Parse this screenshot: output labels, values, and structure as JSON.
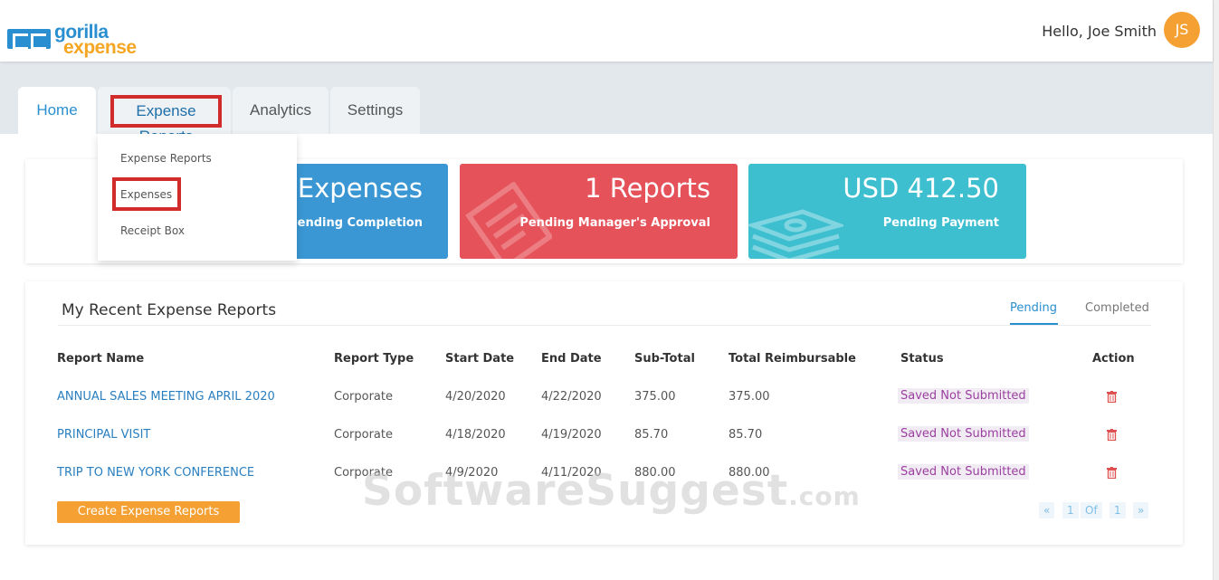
{
  "header": {
    "logo_text_top": "gorilla",
    "logo_text_bottom": "expense",
    "greeting": "Hello, Joe Smith",
    "avatar_initials": "JS"
  },
  "tabs": [
    {
      "label": "Home",
      "active": true
    },
    {
      "label": "Expense Reports",
      "highlighted": true
    },
    {
      "label": "Analytics"
    },
    {
      "label": "Settings"
    }
  ],
  "dropdown": {
    "items": [
      "Expense Reports",
      "Expenses",
      "Receipt Box"
    ]
  },
  "summary": {
    "cards": [
      {
        "big": "Expenses",
        "sub": "Pending Completion",
        "color": "#3a97d3"
      },
      {
        "big": "1 Reports",
        "sub": "Pending Manager's Approval",
        "color": "#e5525a"
      },
      {
        "big": "USD 412.50",
        "sub": "Pending Payment",
        "color": "#3dbfd0"
      }
    ]
  },
  "reports": {
    "title": "My Recent Expense Reports",
    "tab_pending": "Pending",
    "tab_completed": "Completed",
    "columns": [
      "Report Name",
      "Report Type",
      "Start Date",
      "End Date",
      "Sub-Total",
      "Total Reimbursable",
      "Status",
      "Action"
    ],
    "rows": [
      {
        "name": "ANNUAL SALES MEETING APRIL 2020",
        "type": "Corporate",
        "start": "4/20/2020",
        "end": "4/22/2020",
        "subtotal": "375.00",
        "reimb": "375.00",
        "status": "Saved Not Submitted"
      },
      {
        "name": "PRINCIPAL VISIT",
        "type": "Corporate",
        "start": "4/18/2020",
        "end": "4/19/2020",
        "subtotal": "85.70",
        "reimb": "85.70",
        "status": "Saved Not Submitted"
      },
      {
        "name": "TRIP TO NEW YORK CONFERENCE",
        "type": "Corporate",
        "start": "4/9/2020",
        "end": "4/11/2020",
        "subtotal": "880.00",
        "reimb": "880.00",
        "status": "Saved Not Submitted"
      }
    ],
    "create_button": "Create Expense Reports",
    "pager": {
      "first": "«",
      "page": "1",
      "of": "Of",
      "total": "1",
      "last": "»"
    }
  },
  "watermark": {
    "main": "SoftwareSuggest",
    "suffix": ".com"
  },
  "colors": {
    "accent": "#2a8fd0",
    "orange": "#f5a033",
    "highlight_border": "#d22b2b"
  }
}
